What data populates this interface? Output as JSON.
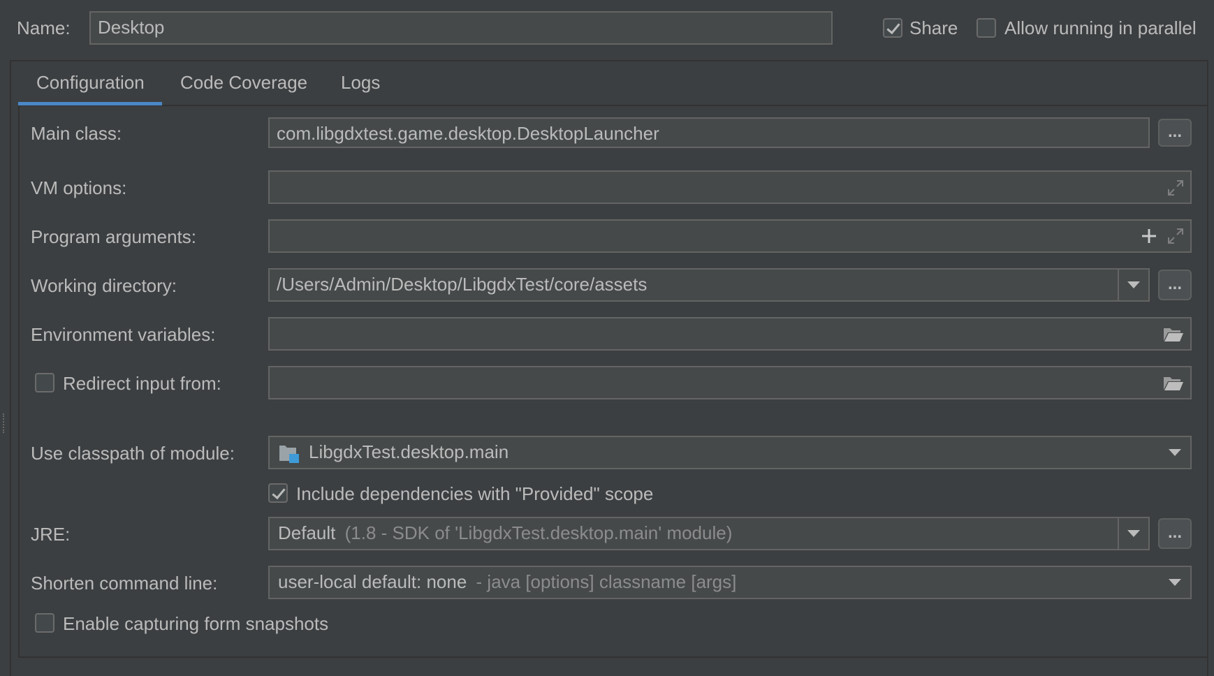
{
  "header": {
    "name_label": "Name:",
    "name_value": "Desktop",
    "share_label": "Share",
    "share_checked": true,
    "parallel_label": "Allow running in parallel",
    "parallel_checked": false
  },
  "tabs": [
    {
      "label": "Configuration",
      "active": true
    },
    {
      "label": "Code Coverage",
      "active": false
    },
    {
      "label": "Logs",
      "active": false
    }
  ],
  "form": {
    "main_class": {
      "label": "Main class:",
      "value": "com.libgdxtest.game.desktop.DesktopLauncher",
      "button": "..."
    },
    "vm_options": {
      "label": "VM options:",
      "value": ""
    },
    "program_arguments": {
      "label": "Program arguments:",
      "value": ""
    },
    "working_directory": {
      "label": "Working directory:",
      "value": "/Users/Admin/Desktop/LibgdxTest/core/assets",
      "button": "..."
    },
    "environment_variables": {
      "label": "Environment variables:",
      "value": ""
    },
    "redirect_input": {
      "label": "Redirect input from:",
      "checked": false,
      "value": ""
    },
    "classpath_module": {
      "label": "Use classpath of module:",
      "value": "LibgdxTest.desktop.main"
    },
    "include_provided": {
      "label": "Include dependencies with \"Provided\" scope",
      "checked": true
    },
    "jre": {
      "label": "JRE:",
      "value": "Default",
      "hint": "(1.8 - SDK of 'LibgdxTest.desktop.main' module)",
      "button": "..."
    },
    "shorten_command_line": {
      "label": "Shorten command line:",
      "value": "user-local default: none",
      "hint": "- java [options] classname [args]"
    },
    "form_snapshots": {
      "label": "Enable capturing form snapshots",
      "checked": false
    }
  },
  "colors": {
    "background": "#3c3f41",
    "field": "#45494a",
    "tab_underline": "#4a88c7",
    "text": "#bbbbbb"
  }
}
